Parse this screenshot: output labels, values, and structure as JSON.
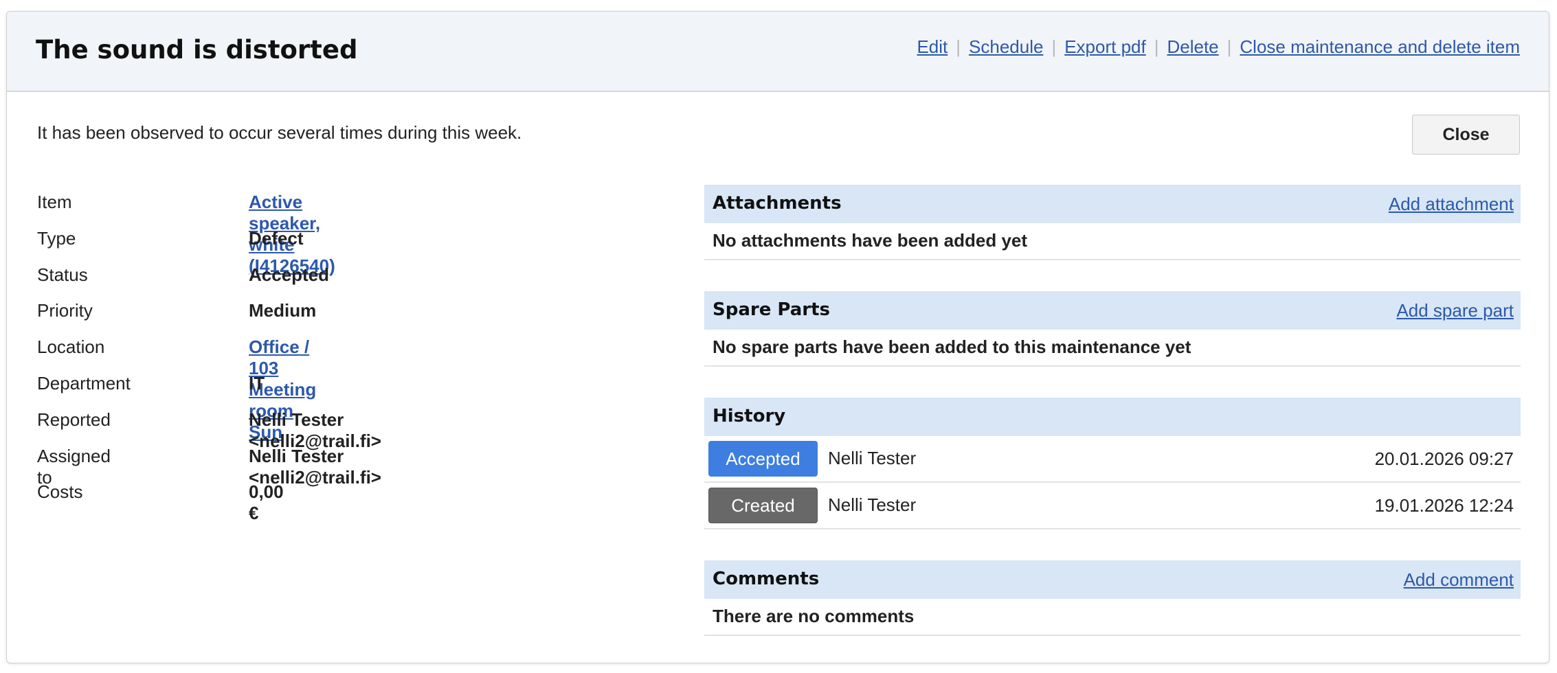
{
  "header": {
    "title": "The sound is distorted",
    "actions": {
      "edit": "Edit",
      "schedule": "Schedule",
      "export_pdf": "Export pdf",
      "delete": "Delete",
      "close_and_delete": "Close maintenance and delete item",
      "separator": "|"
    }
  },
  "description": "It has been observed to occur several times during this week.",
  "close_button": "Close",
  "details": {
    "item": {
      "label": "Item",
      "value": "Active speaker, white (I4126540)"
    },
    "type": {
      "label": "Type",
      "value": "Defect"
    },
    "status": {
      "label": "Status",
      "value": "Accepted"
    },
    "priority": {
      "label": "Priority",
      "value": "Medium"
    },
    "location": {
      "label": "Location",
      "value": "Office / 103 Meeting room Sun"
    },
    "department": {
      "label": "Department",
      "value": "IT"
    },
    "reported": {
      "label": "Reported",
      "value": "Nelli Tester <nelli2@trail.fi>"
    },
    "assigned": {
      "label": "Assigned to",
      "value": "Nelli Tester <nelli2@trail.fi>"
    },
    "costs": {
      "label": "Costs",
      "value": "0,00 €"
    }
  },
  "attachments": {
    "title": "Attachments",
    "action": "Add attachment",
    "empty": "No attachments have been added yet"
  },
  "spare_parts": {
    "title": "Spare Parts",
    "action": "Add spare part",
    "empty": "No spare parts have been added to this maintenance yet"
  },
  "history": {
    "title": "History",
    "entries": [
      {
        "status": "Accepted",
        "user": "Nelli Tester",
        "date": "20.01.2026 09:27",
        "color": "#3d7ee0"
      },
      {
        "status": "Created",
        "user": "Nelli Tester",
        "date": "19.01.2026 12:24",
        "color": "#686868"
      }
    ]
  },
  "comments": {
    "title": "Comments",
    "action": "Add comment",
    "empty": "There are no comments"
  }
}
